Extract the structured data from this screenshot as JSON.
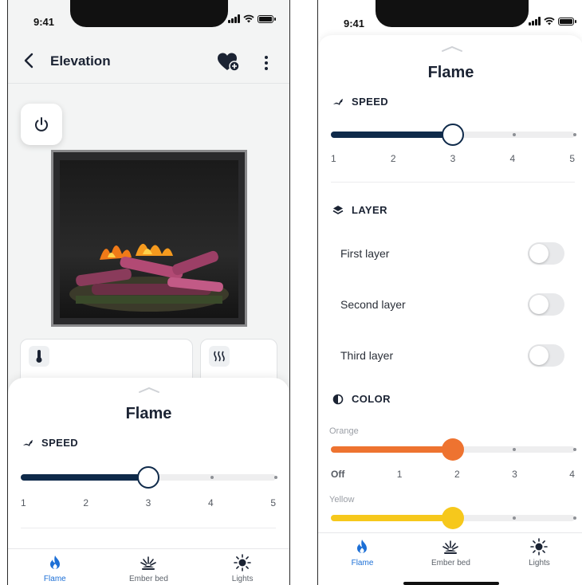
{
  "left": {
    "status_time": "9:41",
    "title": "Elevation",
    "sheet": {
      "title": "Flame",
      "speed": {
        "label": "SPEED",
        "ticks": [
          "1",
          "2",
          "3",
          "4",
          "5"
        ],
        "value": 3
      }
    },
    "tabs": [
      {
        "label": "Flame",
        "icon": "flame-icon",
        "active": true
      },
      {
        "label": "Ember bed",
        "icon": "ember-bed-icon",
        "active": false
      },
      {
        "label": "Lights",
        "icon": "sun-icon",
        "active": false
      }
    ]
  },
  "right": {
    "status_time": "9:41",
    "title": "Flame",
    "speed": {
      "label": "SPEED",
      "ticks": [
        "1",
        "2",
        "3",
        "4",
        "5"
      ],
      "value": 3
    },
    "layer": {
      "label": "LAYER",
      "items": [
        {
          "label": "First layer",
          "on": false
        },
        {
          "label": "Second layer",
          "on": false
        },
        {
          "label": "Third layer",
          "on": false
        }
      ]
    },
    "color": {
      "label": "COLOR",
      "orange": {
        "label": "Orange",
        "ticks": [
          "Off",
          "1",
          "2",
          "3",
          "4"
        ],
        "value": 2
      },
      "yellow": {
        "label": "Yellow",
        "value": 2
      }
    },
    "tabs": [
      {
        "label": "Flame",
        "icon": "flame-icon",
        "active": true
      },
      {
        "label": "Ember bed",
        "icon": "ember-bed-icon",
        "active": false
      },
      {
        "label": "Lights",
        "icon": "sun-icon",
        "active": false
      }
    ]
  },
  "colors": {
    "navy": "#0f2a4a",
    "orange": "#ee7330",
    "yellow": "#f6c81c",
    "accent": "#1c6fd6"
  }
}
